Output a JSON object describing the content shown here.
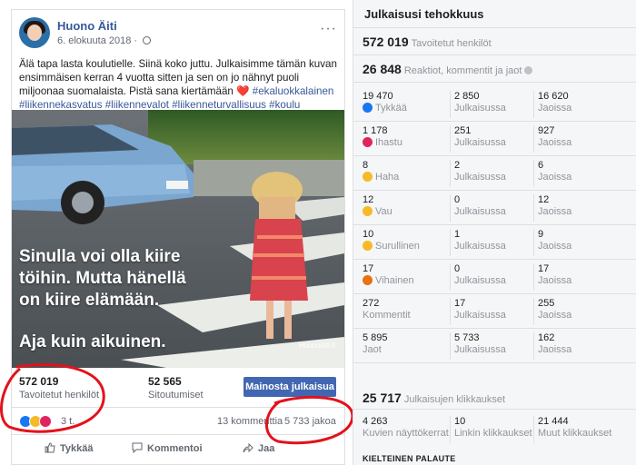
{
  "post": {
    "author": "Huono Äiti",
    "date": "6. elokuuta 2018 · ",
    "menu_glyph": "···",
    "text_main": "Älä tapa lasta koulutielle. Siinä koko juttu. Julkaisimme tämän kuvan ensimmäisen kerran 4 vuotta sitten ja sen on jo nähnyt puoli miljoonaa suomalaista. Pistä sana kiertämään ",
    "heart": "❤️",
    "text_tags": "#ekaluokkalainen #liikennekasvatus #liikennevalot #liikenneturvallisuus #koulu",
    "image_text_line1": "Sinulla voi olla kiire",
    "image_text_line2": "töihin. Mutta hänellä",
    "image_text_line3": "on kiire elämään.",
    "image_text_line4": "Aja kuin aikuinen.",
    "image_watermark": "Huonoäiti.fi",
    "reach_value": "572 019",
    "reach_label": "Tavoitetut henkilöt",
    "engagement_value": "52 565",
    "engagement_label": "Sitoutumiset",
    "promote_label": "Mainosta julkaisua",
    "reactions_count": "3 t.",
    "comments_count": "13 kommenttia",
    "shares_count": "5 733 jakoa",
    "action_like": "Tykkää",
    "action_comment": "Kommentoi",
    "action_share": "Jaa"
  },
  "insights": {
    "title": "Julkaisusi tehokkuus",
    "reach_value": "572 019",
    "reach_label": "Tavoitetut henkilöt",
    "engagement_value": "26 848",
    "engagement_label": "Reaktiot, kommentit ja jaot",
    "rows": [
      {
        "total": "19 470",
        "name": "Tykkää",
        "on_post": "2 850",
        "on_post_label": "Julkaisussa",
        "on_shares": "16 620",
        "on_shares_label": "Jaoissa",
        "color": "#1877f2"
      },
      {
        "total": "1 178",
        "name": "Ihastu",
        "on_post": "251",
        "on_post_label": "Julkaisussa",
        "on_shares": "927",
        "on_shares_label": "Jaoissa",
        "color": "#e0245e"
      },
      {
        "total": "8",
        "name": "Haha",
        "on_post": "2",
        "on_post_label": "Julkaisussa",
        "on_shares": "6",
        "on_shares_label": "Jaoissa",
        "color": "#f7b928"
      },
      {
        "total": "12",
        "name": "Vau",
        "on_post": "0",
        "on_post_label": "Julkaisussa",
        "on_shares": "12",
        "on_shares_label": "Jaoissa",
        "color": "#f7b928"
      },
      {
        "total": "10",
        "name": "Surullinen",
        "on_post": "1",
        "on_post_label": "Julkaisussa",
        "on_shares": "9",
        "on_shares_label": "Jaoissa",
        "color": "#f7b928"
      },
      {
        "total": "17",
        "name": "Vihainen",
        "on_post": "0",
        "on_post_label": "Julkaisussa",
        "on_shares": "17",
        "on_shares_label": "Jaoissa",
        "color": "#e9710f"
      },
      {
        "total": "272",
        "name": "Kommentit",
        "on_post": "17",
        "on_post_label": "Julkaisussa",
        "on_shares": "255",
        "on_shares_label": "Jaoissa",
        "color": ""
      },
      {
        "total": "5 895",
        "name": "Jaot",
        "on_post": "5 733",
        "on_post_label": "Julkaisussa",
        "on_shares": "162",
        "on_shares_label": "Jaoissa",
        "color": ""
      }
    ],
    "clicks_value": "25 717",
    "clicks_label": "Julkaisujen klikkaukset",
    "photo_views": "4 263",
    "photo_views_label": "Kuvien näyttökerrat",
    "link_clicks": "10",
    "link_clicks_label": "Linkin klikkaukset",
    "other_clicks": "21 444",
    "other_clicks_label": "Muut klikkaukset",
    "negative_feedback": "KIELTEINEN PALAUTE"
  }
}
